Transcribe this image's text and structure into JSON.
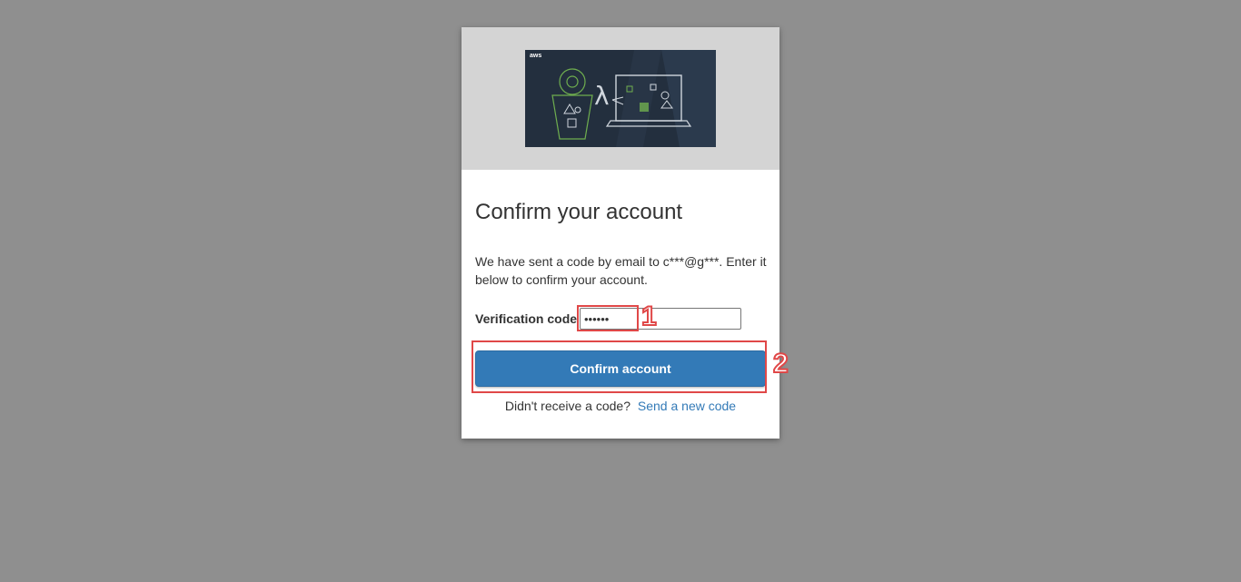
{
  "banner": {
    "image_name": "aws-serverless-illustration",
    "logo_text": "aws",
    "lambda_glyph": "λ"
  },
  "form": {
    "title": "Confirm your account",
    "description": "We have sent a code by email to c***@g***. Enter it below to confirm your account.",
    "code_label": "Verification code",
    "code_value": "••••••",
    "submit_label": "Confirm account",
    "resend_prompt": "Didn't receive a code?",
    "resend_link": "Send a new code"
  },
  "annotations": {
    "step_1": "1",
    "step_2": "2"
  },
  "colors": {
    "page_background": "#8f8f8f",
    "banner_background": "#d4d4d4",
    "button": "#337ab7",
    "link": "#337ab7",
    "highlight": "#e04848"
  }
}
